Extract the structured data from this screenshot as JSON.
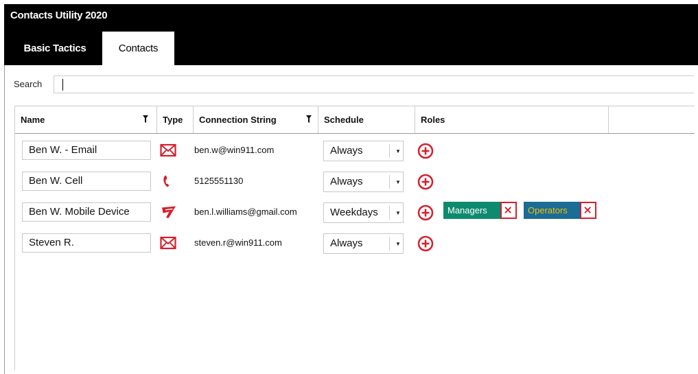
{
  "app": {
    "title": "Contacts Utility 2020"
  },
  "tabs": [
    {
      "label": "Basic Tactics",
      "active": false
    },
    {
      "label": "Contacts",
      "active": true
    }
  ],
  "search": {
    "label": "Search",
    "value": ""
  },
  "columns": {
    "name": "Name",
    "type": "Type",
    "connection": "Connection String",
    "schedule": "Schedule",
    "roles": "Roles"
  },
  "contacts": [
    {
      "name": "Ben W. - Email",
      "type": "email-icon",
      "connection": "ben.w@win911.com",
      "schedule": "Always",
      "roles": []
    },
    {
      "name": "Ben W. Cell",
      "type": "phone-icon",
      "connection": "5125551130",
      "schedule": "Always",
      "roles": []
    },
    {
      "name": "Ben W. Mobile Device",
      "type": "mobile-app-icon",
      "connection": "ben.l.williams@gmail.com",
      "schedule": "Weekdays",
      "roles": [
        "Managers",
        "Operators"
      ]
    },
    {
      "name": "Steven R.",
      "type": "email-icon",
      "connection": "steven.r@win911.com",
      "schedule": "Always",
      "roles": []
    }
  ],
  "colors": {
    "accent_red": "#d51f2c",
    "managers_badge": "#0e8a6f",
    "operators_badge": "#1b6c96",
    "operators_text": "#f2c200"
  }
}
